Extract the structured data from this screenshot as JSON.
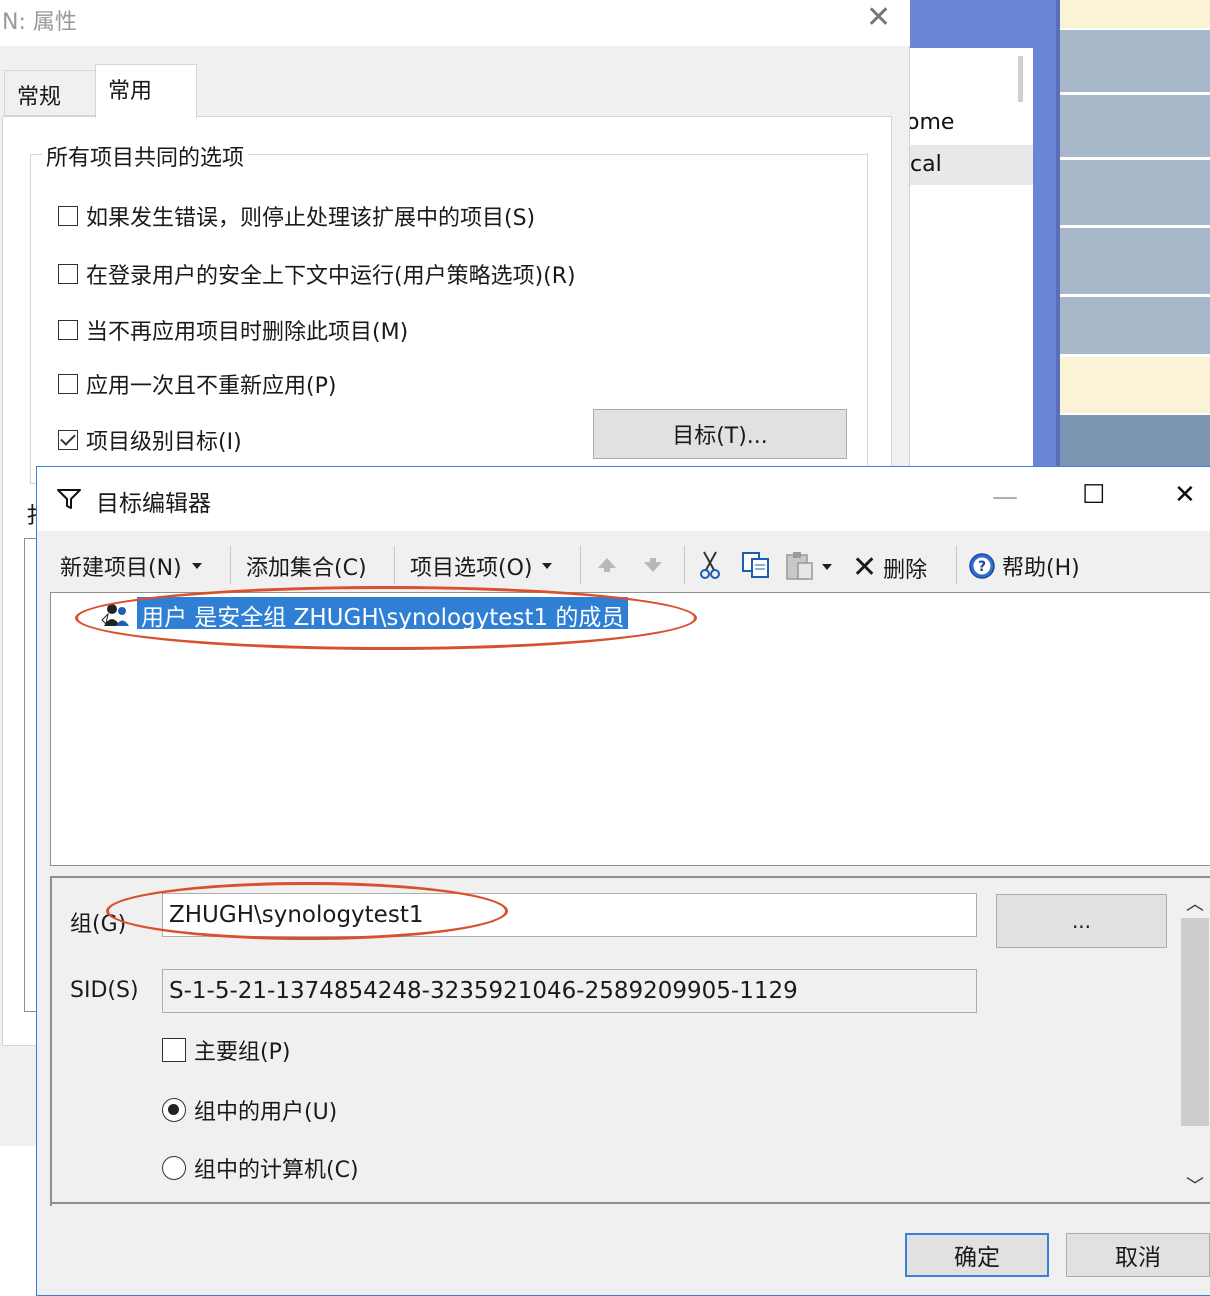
{
  "background_app": {
    "list_items": [
      "ome",
      "cal"
    ],
    "stripe_colors": [
      "#fbf3d6",
      "#a8b8cb",
      "#a8b8cb",
      "#a8b8cb",
      "#a8b8cb",
      "#a8b8cb",
      "#fbf3d6",
      "#7b96b2",
      "#a8b8cb"
    ]
  },
  "properties_dialog": {
    "title": "N: 属性",
    "tabs": [
      {
        "label": "常规",
        "active": false
      },
      {
        "label": "常用",
        "active": true
      }
    ],
    "group_label": "所有项目共同的选项",
    "options": [
      {
        "label": "如果发生错误，则停止处理该扩展中的项目(S)",
        "checked": false
      },
      {
        "label": "在登录用户的安全上下文中运行(用户策略选项)(R)",
        "checked": false
      },
      {
        "label": "当不再应用项目时删除此项目(M)",
        "checked": false
      },
      {
        "label": "应用一次且不重新应用(P)",
        "checked": false
      },
      {
        "label": "项目级别目标(I)",
        "checked": true
      }
    ],
    "targeting_button": "目标(T)...",
    "cut_label": "扌"
  },
  "target_editor": {
    "title": "目标编辑器",
    "window_controls": {
      "minimize": "—",
      "maximize": "☐",
      "close": "✕"
    },
    "toolbar": {
      "new_item": "新建项目(N)",
      "add_collection": "添加集合(C)",
      "item_options": "项目选项(O)",
      "delete": "删除",
      "help": "帮助(H)"
    },
    "tree_items": [
      {
        "label": "用户 是安全组 ZHUGH\\synologytest1 的成员",
        "selected": true
      }
    ],
    "properties": {
      "group_label": "组(G)",
      "group_value": "ZHUGH\\synologytest1",
      "browse_button": "...",
      "sid_label": "SID(S)",
      "sid_value": "S-1-5-21-1374854248-3235921046-2589209905-1129",
      "primary_group_label": "主要组(P)",
      "primary_group_checked": false,
      "radio_user_label": "组中的用户(U)",
      "radio_computer_label": "组中的计算机(C)",
      "selected_radio": "user"
    },
    "ok_button": "确定",
    "cancel_button": "取消"
  },
  "colors": {
    "selection": "#2f80d5",
    "annotation_oval": "#d9502c",
    "editor_border": "#3d7ed6"
  }
}
